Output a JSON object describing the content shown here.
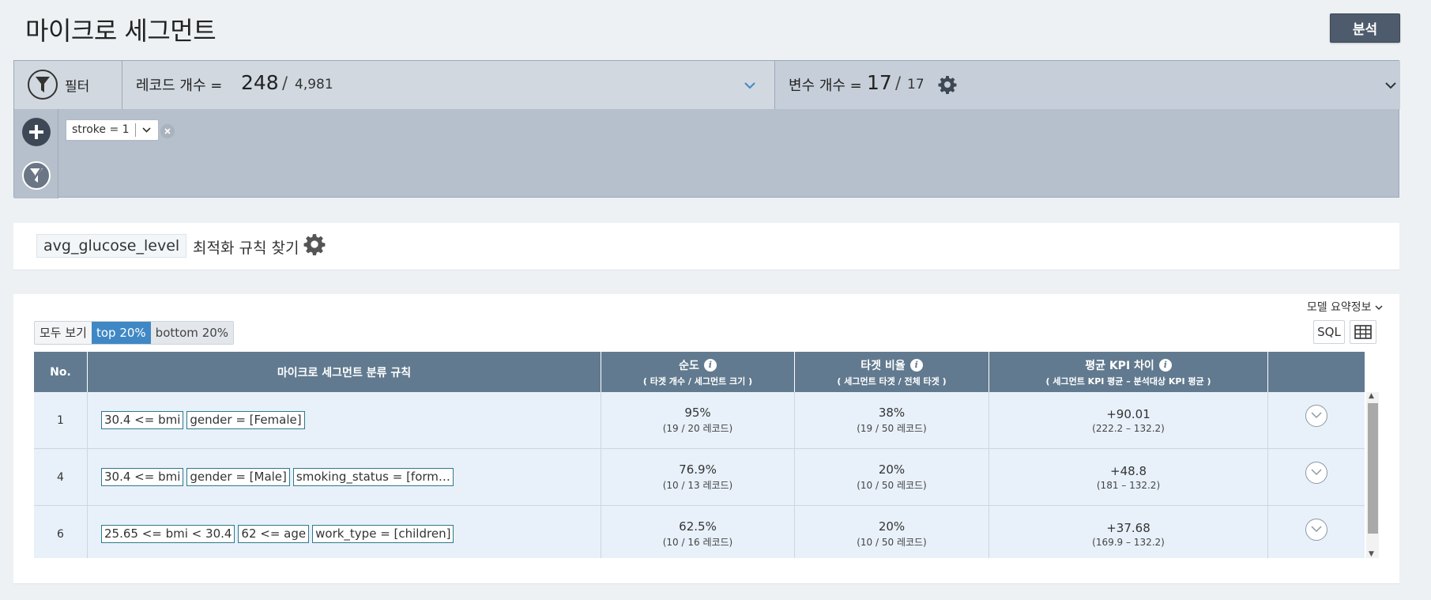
{
  "page": {
    "title": "마이크로 세그먼트",
    "analyze_button": "분석"
  },
  "filter_bar": {
    "filter_label": "필터",
    "records_label": "레코드 개수 =",
    "records_selected": "248",
    "records_total": "4,981",
    "vars_label": "변수 개수 =",
    "vars_selected": "17",
    "vars_total": "17",
    "slash": "/",
    "chips": [
      {
        "text": "stroke = 1"
      }
    ]
  },
  "target": {
    "variable": "avg_glucose_level",
    "text": "최적화 규칙 찾기"
  },
  "results": {
    "model_summary": "모델 요약정보",
    "view_options": [
      "모두 보기",
      "top 20%",
      "bottom 20%"
    ],
    "active_view": "top 20%",
    "sql_button": "SQL",
    "columns": {
      "no": "No.",
      "rules": "마이크로 세그먼트 분류 규칙",
      "purity": "순도",
      "purity_sub": "( 타겟 개수 / 세그먼트 크기 )",
      "target_ratio": "타겟 비율",
      "target_ratio_sub": "( 세그먼트 타겟 / 전체 타겟 )",
      "kpi_diff": "평균 KPI 차이",
      "kpi_diff_sub": "( 세그먼트 KPI 평균 – 분석대상 KPI 평균 )"
    },
    "rows": [
      {
        "no": "1",
        "rules": [
          "30.4 <= bmi",
          "gender = [Female]"
        ],
        "purity": "95%",
        "purity_sub": "(19 / 20 레코드)",
        "ratio": "38%",
        "ratio_sub": "(19 / 50 레코드)",
        "kpi": "+90.01",
        "kpi_sub": "(222.2 – 132.2)"
      },
      {
        "no": "4",
        "rules": [
          "30.4 <= bmi",
          "gender = [Male]",
          "smoking_status = [form…"
        ],
        "purity": "76.9%",
        "purity_sub": "(10 / 13 레코드)",
        "ratio": "20%",
        "ratio_sub": "(10 / 50 레코드)",
        "kpi": "+48.8",
        "kpi_sub": "(181 – 132.2)"
      },
      {
        "no": "6",
        "rules": [
          "25.65 <= bmi < 30.4",
          "62 <= age",
          "work_type = [children]"
        ],
        "purity": "62.5%",
        "purity_sub": "(10 / 16 레코드)",
        "ratio": "20%",
        "ratio_sub": "(10 / 50 레코드)",
        "kpi": "+37.68",
        "kpi_sub": "(169.9 – 132.2)"
      }
    ]
  }
}
